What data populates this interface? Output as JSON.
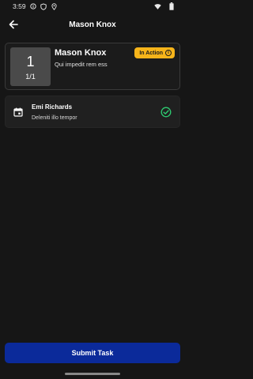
{
  "status_bar": {
    "time": "3:59",
    "icons": [
      "info-icon",
      "shield-icon",
      "location-icon",
      "wifi-icon",
      "battery-icon"
    ]
  },
  "header": {
    "title": "Mason Knox",
    "back_icon": "arrow-left-icon"
  },
  "task": {
    "name": "Mason Knox",
    "description": "Qui impedit rem ess",
    "counter": "1",
    "fraction": "1/1",
    "status": "In Action",
    "status_color": "#f6b41a"
  },
  "assignee": {
    "name": "Emi Richards",
    "description": "Deleniti illo tempor",
    "icon": "calendar-icon",
    "check_icon": "check-circle-icon",
    "check_color": "#2ecc71"
  },
  "footer": {
    "submit_label": "Submit Task",
    "button_color": "#0b2a9a"
  }
}
